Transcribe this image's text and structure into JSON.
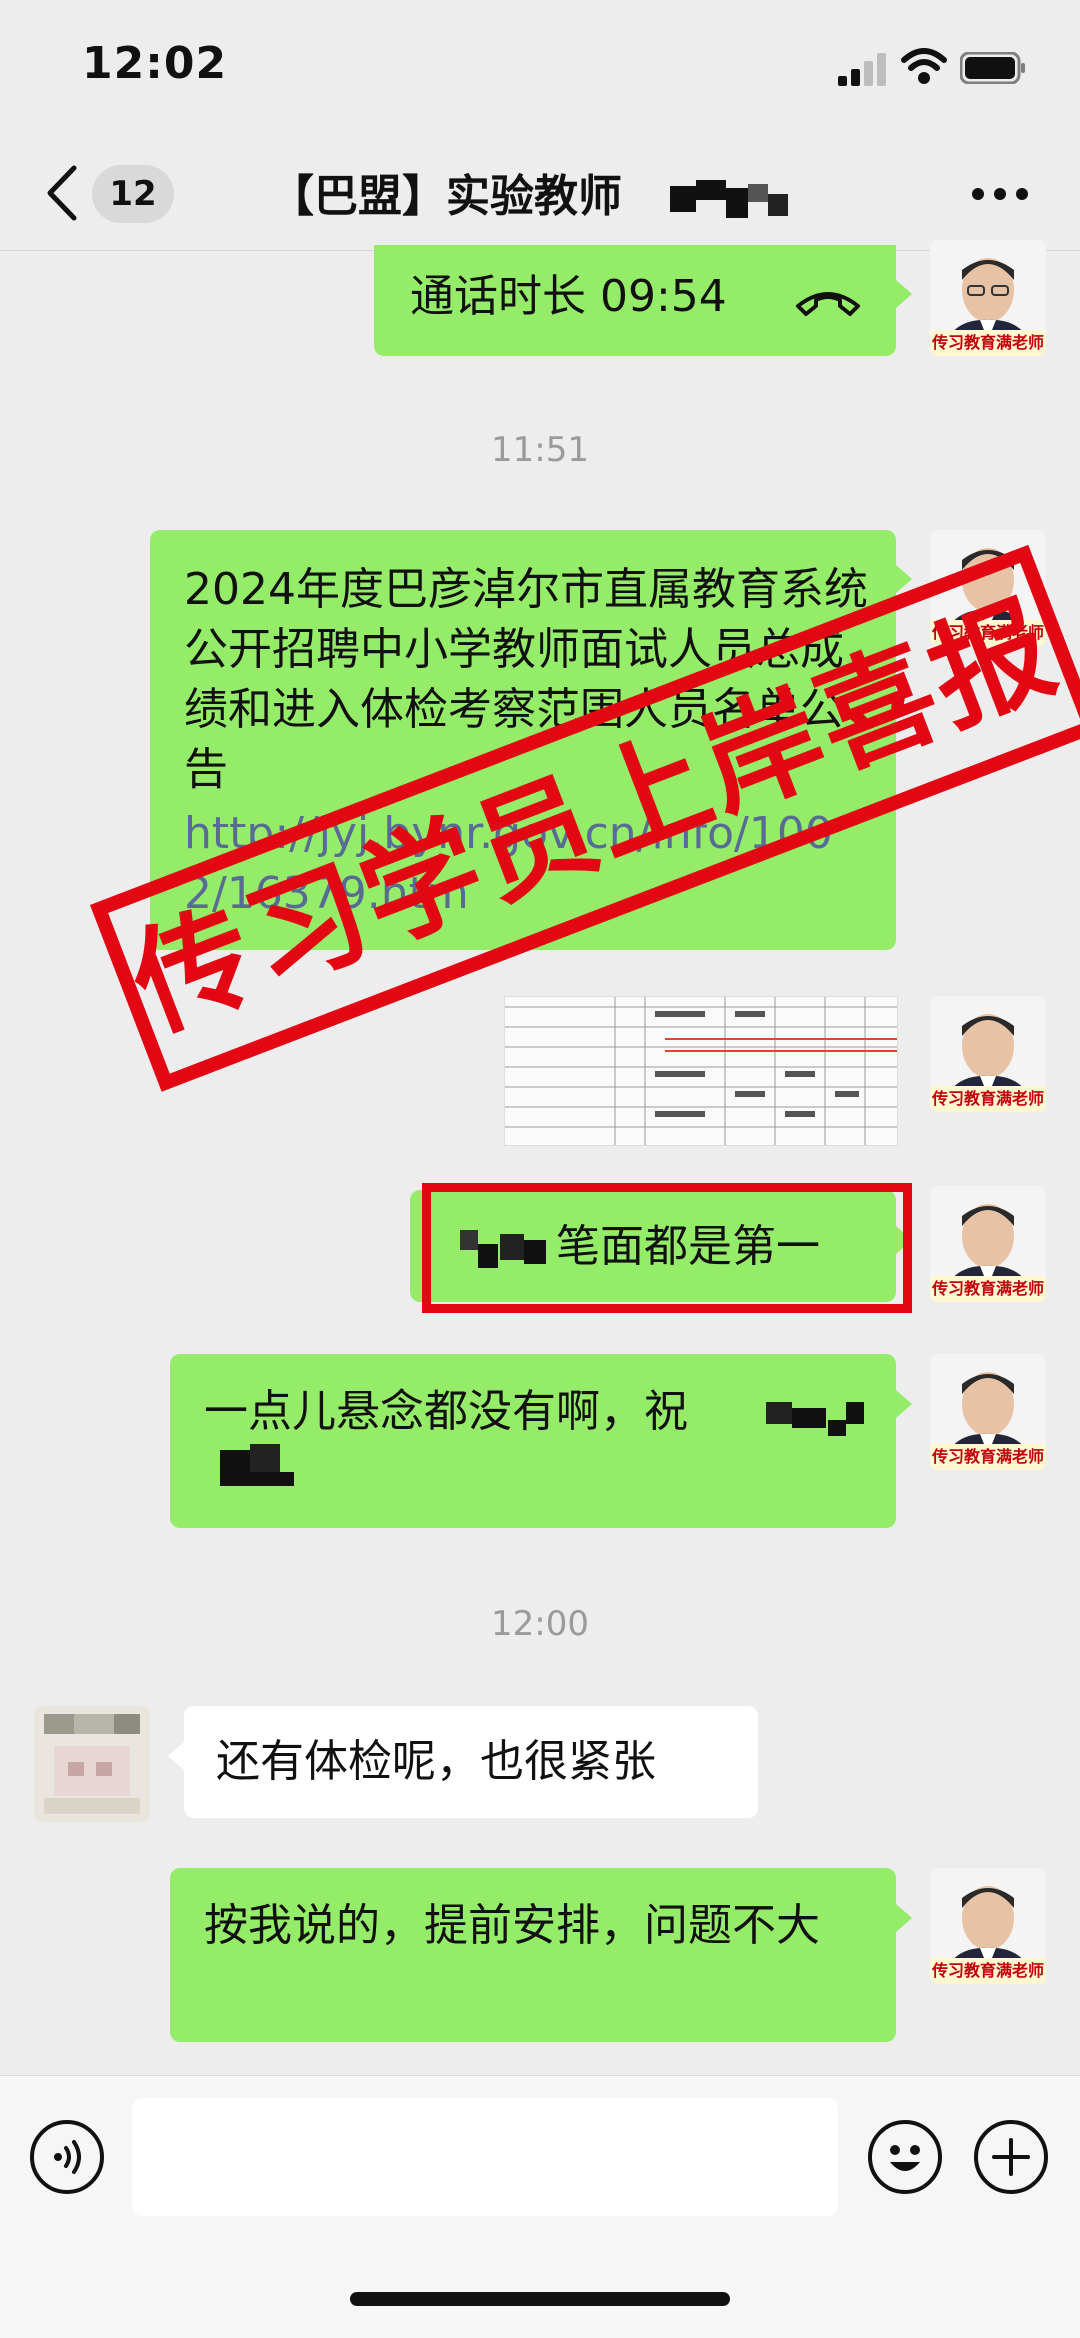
{
  "status_bar": {
    "time": "12:02"
  },
  "header": {
    "back_count": "12",
    "title": "【巴盟】实验教师"
  },
  "avatar_label": "传习教育满老师",
  "messages": {
    "call": {
      "text": "通话时长 09:54"
    },
    "time1": "11:51",
    "announcement": {
      "text": "2024年度巴彦淖尔市直属教育系统公开招聘中小学教师面试人员总成绩和进入体检考察范围人员名单公告",
      "link": "http://jyj.bynr.gov.cn/info/1002/16379.htm"
    },
    "score_msg": "笔面都是第一",
    "reply1": "一点儿悬念都没有啊，祝",
    "time2": "12:00",
    "other1": "还有体检呢，也很紧张",
    "reply2": "按我说的，提前安排，问题不大"
  },
  "stamp": {
    "text": "传习学员上岸喜报",
    "color": "#e30613"
  },
  "colors": {
    "bubble_me": "#95ec69",
    "bubble_other": "#ffffff",
    "link": "#576b95",
    "background": "#ededed"
  },
  "icons": {
    "signal": "cellular-signal-icon",
    "wifi": "wifi-icon",
    "battery": "battery-icon",
    "back": "chevron-left-icon",
    "more": "more-icon",
    "phone": "phone-hangup-icon",
    "voice": "voice-icon",
    "emoji": "emoji-icon",
    "plus": "plus-icon"
  }
}
